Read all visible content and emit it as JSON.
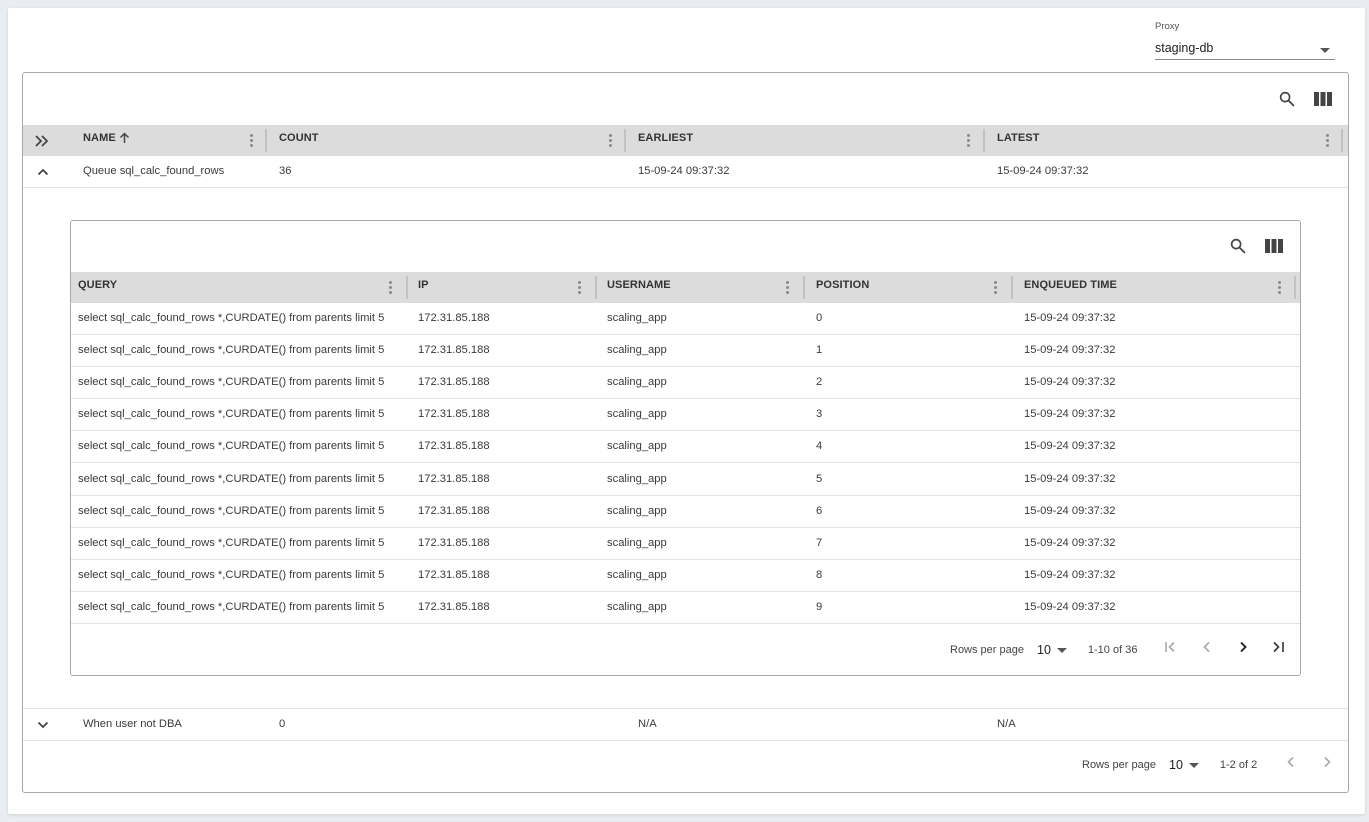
{
  "proxy": {
    "label": "Proxy",
    "value": "staging-db"
  },
  "outer_table": {
    "headers": {
      "name": "NAME",
      "count": "COUNT",
      "earliest": "EARLIEST",
      "latest": "LATEST"
    },
    "rows": [
      {
        "name": "Queue sql_calc_found_rows",
        "count": "36",
        "earliest": "15-09-24 09:37:32",
        "latest": "15-09-24 09:37:32",
        "expanded": true
      },
      {
        "name": "When user not DBA",
        "count": "0",
        "earliest": "N/A",
        "latest": "N/A",
        "expanded": false
      }
    ],
    "pagination": {
      "rows_per_page_label": "Rows per page",
      "rows_per_page": "10",
      "range": "1-2 of 2"
    }
  },
  "inner_table": {
    "headers": {
      "query": "QUERY",
      "ip": "IP",
      "username": "USERNAME",
      "position": "POSITION",
      "enqueued": "ENQUEUED TIME"
    },
    "rows": [
      {
        "query": "select sql_calc_found_rows *,CURDATE() from parents limit 5",
        "ip": "172.31.85.188",
        "username": "scaling_app",
        "position": "0",
        "enqueued": "15-09-24 09:37:32"
      },
      {
        "query": "select sql_calc_found_rows *,CURDATE() from parents limit 5",
        "ip": "172.31.85.188",
        "username": "scaling_app",
        "position": "1",
        "enqueued": "15-09-24 09:37:32"
      },
      {
        "query": "select sql_calc_found_rows *,CURDATE() from parents limit 5",
        "ip": "172.31.85.188",
        "username": "scaling_app",
        "position": "2",
        "enqueued": "15-09-24 09:37:32"
      },
      {
        "query": "select sql_calc_found_rows *,CURDATE() from parents limit 5",
        "ip": "172.31.85.188",
        "username": "scaling_app",
        "position": "3",
        "enqueued": "15-09-24 09:37:32"
      },
      {
        "query": "select sql_calc_found_rows *,CURDATE() from parents limit 5",
        "ip": "172.31.85.188",
        "username": "scaling_app",
        "position": "4",
        "enqueued": "15-09-24 09:37:32"
      },
      {
        "query": "select sql_calc_found_rows *,CURDATE() from parents limit 5",
        "ip": "172.31.85.188",
        "username": "scaling_app",
        "position": "5",
        "enqueued": "15-09-24 09:37:32"
      },
      {
        "query": "select sql_calc_found_rows *,CURDATE() from parents limit 5",
        "ip": "172.31.85.188",
        "username": "scaling_app",
        "position": "6",
        "enqueued": "15-09-24 09:37:32"
      },
      {
        "query": "select sql_calc_found_rows *,CURDATE() from parents limit 5",
        "ip": "172.31.85.188",
        "username": "scaling_app",
        "position": "7",
        "enqueued": "15-09-24 09:37:32"
      },
      {
        "query": "select sql_calc_found_rows *,CURDATE() from parents limit 5",
        "ip": "172.31.85.188",
        "username": "scaling_app",
        "position": "8",
        "enqueued": "15-09-24 09:37:32"
      },
      {
        "query": "select sql_calc_found_rows *,CURDATE() from parents limit 5",
        "ip": "172.31.85.188",
        "username": "scaling_app",
        "position": "9",
        "enqueued": "15-09-24 09:37:32"
      }
    ],
    "pagination": {
      "rows_per_page_label": "Rows per page",
      "rows_per_page": "10",
      "range": "1-10 of 36"
    }
  },
  "colors": {
    "header_bg": "#dcdcdc",
    "border": "#a8a8a8",
    "page_bg": "#e9edf1"
  },
  "icons": [
    "search-icon",
    "view-column-icon",
    "expand-all-icon",
    "chevron-up-icon",
    "chevron-down-icon",
    "sort-arrow-up-icon",
    "more-vert-icon",
    "first-page-icon",
    "previous-page-icon",
    "next-page-icon",
    "last-page-icon"
  ]
}
